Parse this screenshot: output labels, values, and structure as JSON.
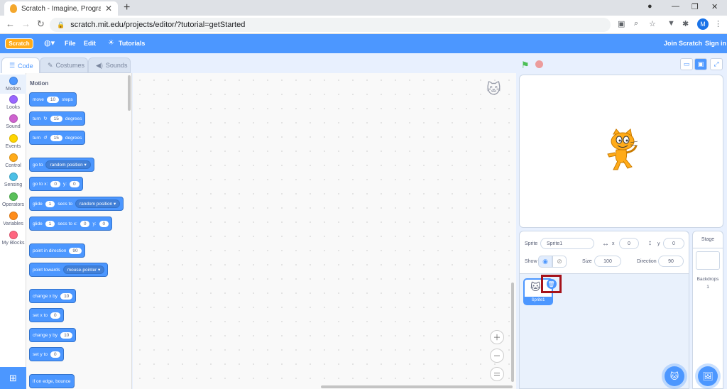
{
  "browser": {
    "tab_title": "Scratch - Imagine, Program, Shar",
    "url": "scratch.mit.edu/projects/editor/?tutorial=getStarted",
    "profile_initial": "M"
  },
  "menubar": {
    "logo": "Scratch",
    "file": "File",
    "edit": "Edit",
    "tutorials": "Tutorials",
    "join": "Join Scratch",
    "signin": "Sign in"
  },
  "editor_tabs": {
    "code": "Code",
    "costumes": "Costumes",
    "sounds": "Sounds"
  },
  "categories": [
    {
      "label": "Motion",
      "color": "#4c97ff"
    },
    {
      "label": "Looks",
      "color": "#9966ff"
    },
    {
      "label": "Sound",
      "color": "#cf63cf"
    },
    {
      "label": "Events",
      "color": "#ffd500"
    },
    {
      "label": "Control",
      "color": "#ffab19"
    },
    {
      "label": "Sensing",
      "color": "#4cbfe6"
    },
    {
      "label": "Operators",
      "color": "#59c059"
    },
    {
      "label": "Variables",
      "color": "#ff8c1a"
    },
    {
      "label": "My Blocks",
      "color": "#ff6680"
    }
  ],
  "palette": {
    "heading": "Motion",
    "move": {
      "a": "move",
      "v": "10",
      "b": "steps"
    },
    "turn_right": {
      "a": "turn",
      "v": "15",
      "b": "degrees"
    },
    "turn_left": {
      "a": "turn",
      "v": "15",
      "b": "degrees"
    },
    "goto": {
      "a": "go to",
      "dd": "random position"
    },
    "gotoxy": {
      "a": "go to x:",
      "x": "0",
      "b": "y:",
      "y": "0"
    },
    "glide_to": {
      "a": "glide",
      "v": "1",
      "b": "secs to",
      "dd": "random position"
    },
    "glide_xy": {
      "a": "glide",
      "v": "1",
      "b": "secs to x:",
      "x": "0",
      "c": "y:",
      "y": "0"
    },
    "point_dir": {
      "a": "point in direction",
      "v": "90"
    },
    "point_towards": {
      "a": "point towards",
      "dd": "mouse-pointer"
    },
    "change_x": {
      "a": "change x by",
      "v": "10"
    },
    "set_x": {
      "a": "set x to",
      "v": "0"
    },
    "change_y": {
      "a": "change y by",
      "v": "10"
    },
    "set_y": {
      "a": "set y to",
      "v": "0"
    },
    "bounce": {
      "a": "if on edge, bounce"
    }
  },
  "sprite_info": {
    "sprite_label": "Sprite",
    "sprite_name": "Sprite1",
    "x_label": "x",
    "x": "0",
    "y_label": "y",
    "y": "0",
    "show_label": "Show",
    "size_label": "Size",
    "size": "100",
    "direction_label": "Direction",
    "direction": "90"
  },
  "sprite_list": [
    {
      "name": "Sprite1"
    }
  ],
  "stage_pane": {
    "title": "Stage",
    "backdrops_label": "Backdrops",
    "backdrops_count": "1"
  }
}
